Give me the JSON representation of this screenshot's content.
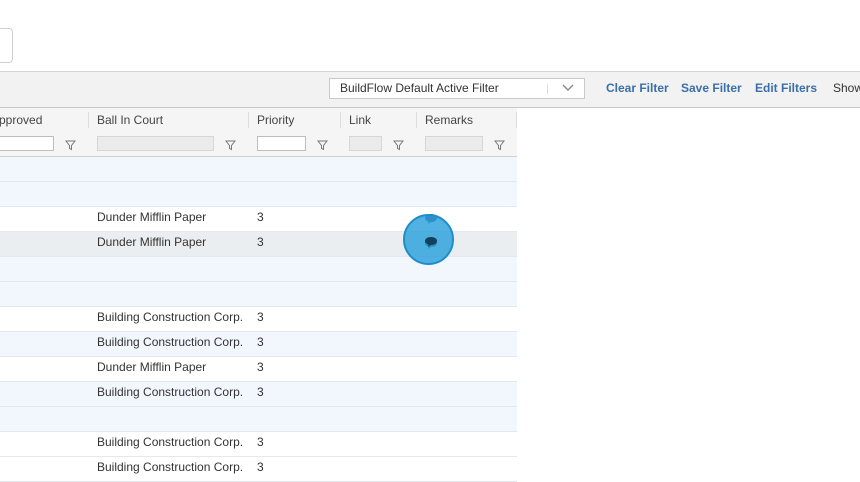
{
  "toolbar": {
    "filter_value": "BuildFlow Default Active Filter",
    "clear_filter": "Clear Filter",
    "save_filter": "Save Filter",
    "edit_filters": "Edit Filters",
    "show": "Show"
  },
  "columns": {
    "approved": "pproved",
    "ball_in_court": "Ball In Court",
    "priority": "Priority",
    "link": "Link",
    "remarks": "Remarks"
  },
  "rows": [
    {
      "ball": "",
      "priority": "",
      "style": "hl",
      "remark": false
    },
    {
      "ball": "",
      "priority": "",
      "style": "hl",
      "remark": false
    },
    {
      "ball": "Dunder Mifflin Paper",
      "priority": "3",
      "style": "plain",
      "remark": true
    },
    {
      "ball": "Dunder Mifflin Paper",
      "priority": "3",
      "style": "sel",
      "remark": true
    },
    {
      "ball": "",
      "priority": "",
      "style": "hl",
      "remark": false
    },
    {
      "ball": "",
      "priority": "",
      "style": "hl",
      "remark": false
    },
    {
      "ball": "Building Construction Corp.",
      "priority": "3",
      "style": "plain",
      "remark": false
    },
    {
      "ball": "Building Construction Corp.",
      "priority": "3",
      "style": "hl",
      "remark": false
    },
    {
      "ball": "Dunder Mifflin Paper",
      "priority": "3",
      "style": "plain",
      "remark": false
    },
    {
      "ball": "Building Construction Corp.",
      "priority": "3",
      "style": "hl",
      "remark": false
    },
    {
      "ball": "",
      "priority": "",
      "style": "hl",
      "remark": false
    },
    {
      "ball": "Building Construction Corp.",
      "priority": "3",
      "style": "plain",
      "remark": false
    },
    {
      "ball": "Building Construction Corp.",
      "priority": "3",
      "style": "plain",
      "remark": false
    }
  ],
  "icons": {
    "filter": "funnel-icon",
    "remark": "comment-bubble-icon",
    "dropdown": "chevron-down-icon"
  },
  "colors": {
    "link": "#3a6fa8",
    "row_highlight": "#f2f7fd",
    "click_marker": "#29a0dc"
  }
}
